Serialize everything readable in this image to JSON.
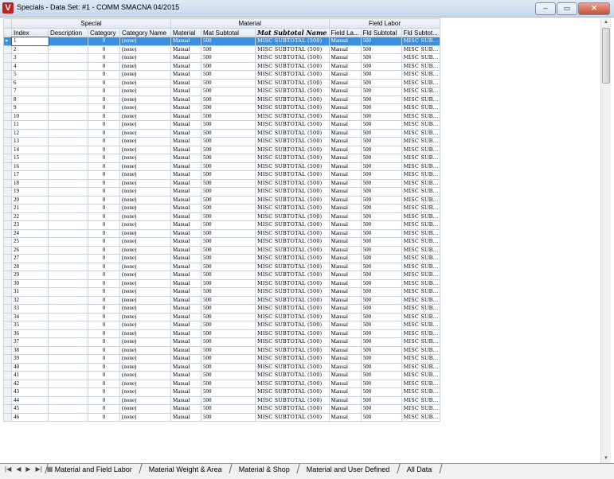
{
  "window": {
    "title": "Specials - Data Set: #1 - COMM SMACNA 04/2015",
    "minimize": "–",
    "maximize": "▭",
    "close": "✕",
    "app_icon": "V"
  },
  "grid": {
    "groups": [
      {
        "label": "Special"
      },
      {
        "label": "Material"
      },
      {
        "label": "Field Labor"
      }
    ],
    "columns": [
      "Index",
      "Description",
      "Category",
      "Category Name",
      "Material",
      "Mat Subtotal",
      "Mat Subtotal Name",
      "Field La...",
      "Fld Subtotal",
      "Fld Subtot..."
    ],
    "row_defaults": {
      "description": "",
      "category": "0",
      "category_name": "(none)",
      "material": "Manual",
      "mat_subtotal": "500",
      "mat_subtotal_name": "MISC SUBTOTAL  (500)",
      "field_labor": "Manual",
      "fld_subtotal": "500",
      "fld_subtotal_name": "MISC SUB..."
    },
    "row_count": 46,
    "active_row": 1
  },
  "tabs": [
    "Material and Field Labor",
    "Material Weight & Area",
    "Material & Shop",
    "Material and User Defined",
    "All Data"
  ],
  "nav": {
    "first": "|◀",
    "prev": "◀",
    "next": "▶",
    "last": "▶|",
    "sheet_icon": "▦"
  }
}
